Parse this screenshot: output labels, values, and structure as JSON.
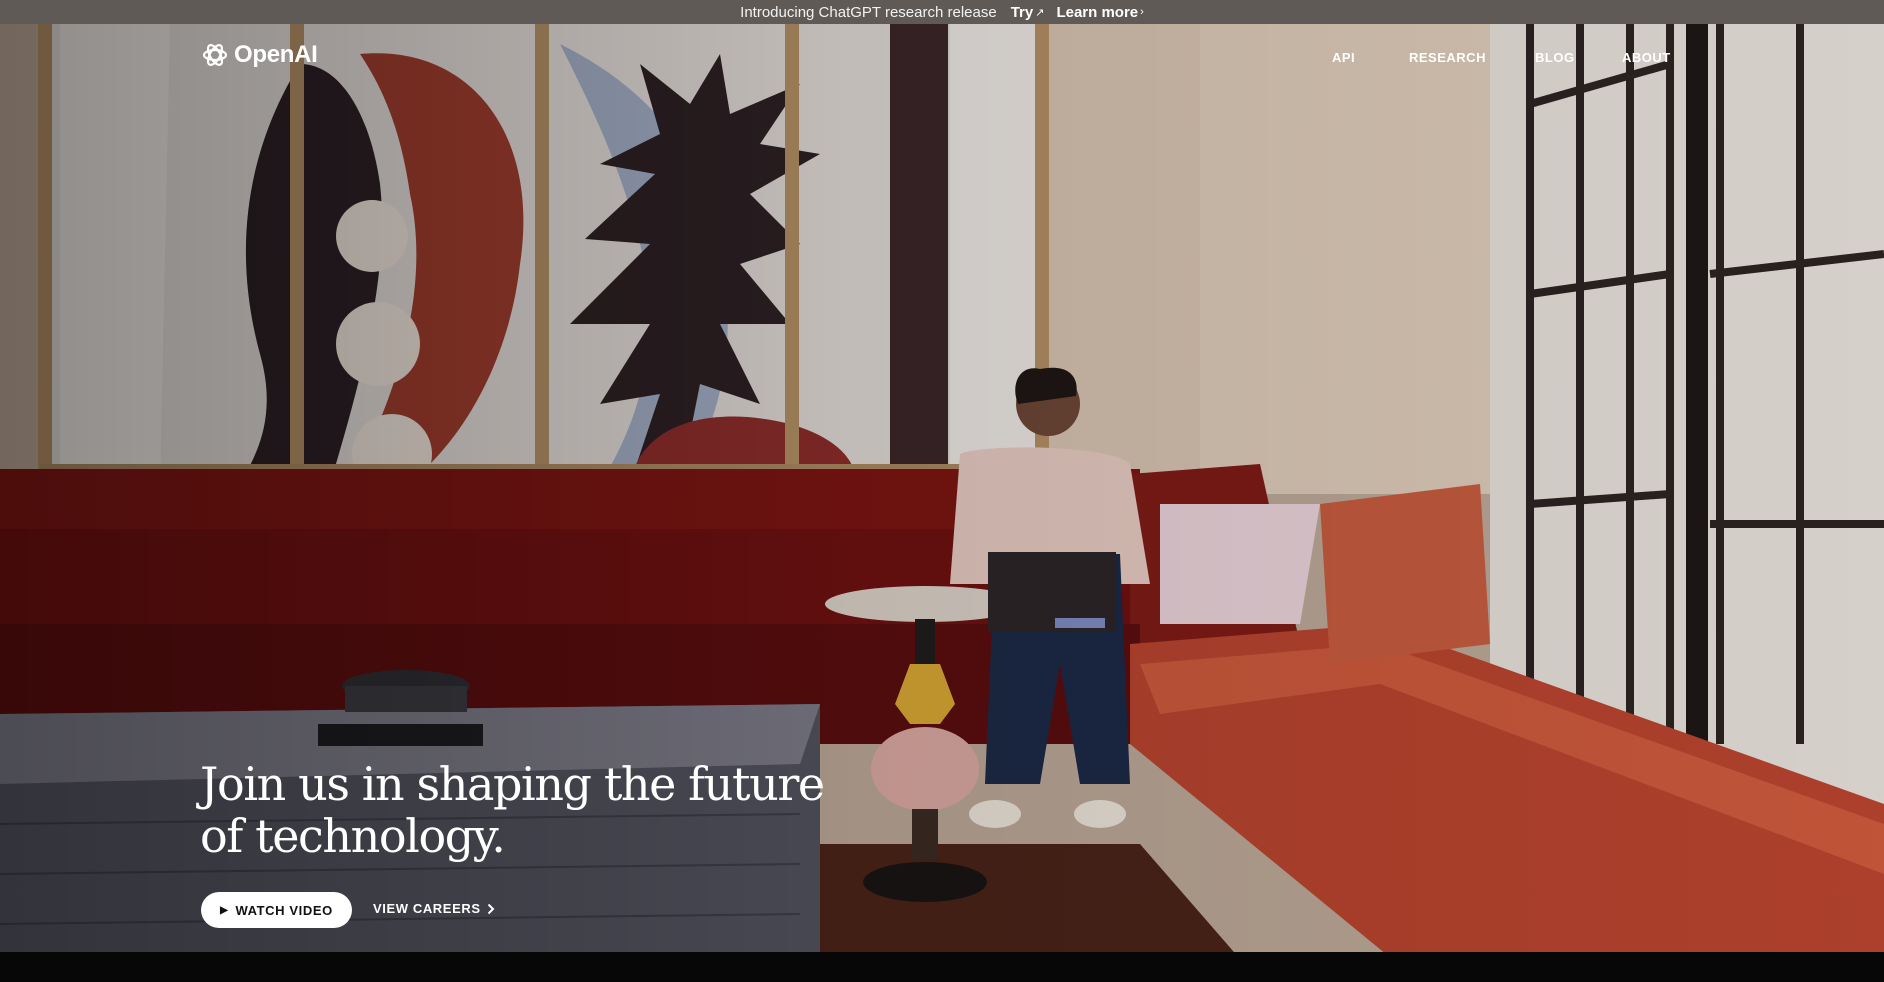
{
  "announcement": {
    "message": "Introducing ChatGPT research release",
    "try_label": "Try",
    "try_glyph": "↗",
    "learn_label": "Learn more",
    "learn_glyph": "›"
  },
  "brand": {
    "name": "OpenAI",
    "logo_icon": "openai-knot-icon"
  },
  "nav": {
    "items": [
      {
        "label": "API"
      },
      {
        "label": "RESEARCH"
      },
      {
        "label": "BLOG"
      },
      {
        "label": "ABOUT"
      }
    ]
  },
  "hero": {
    "headline": "Join us in shaping the future of technology.",
    "watch_label": "WATCH VIDEO",
    "watch_icon": "play-icon",
    "careers_label": "VIEW CAREERS",
    "careers_icon": "chevron-right-icon",
    "background_image": "office-lounge-photo"
  },
  "colors": {
    "announce_bar": "#5f5a56",
    "sofa_red": "#7a1512",
    "cushion_orange": "#c24c33",
    "wall": "#cbb7a6",
    "cta_bg": "#ffffff"
  }
}
